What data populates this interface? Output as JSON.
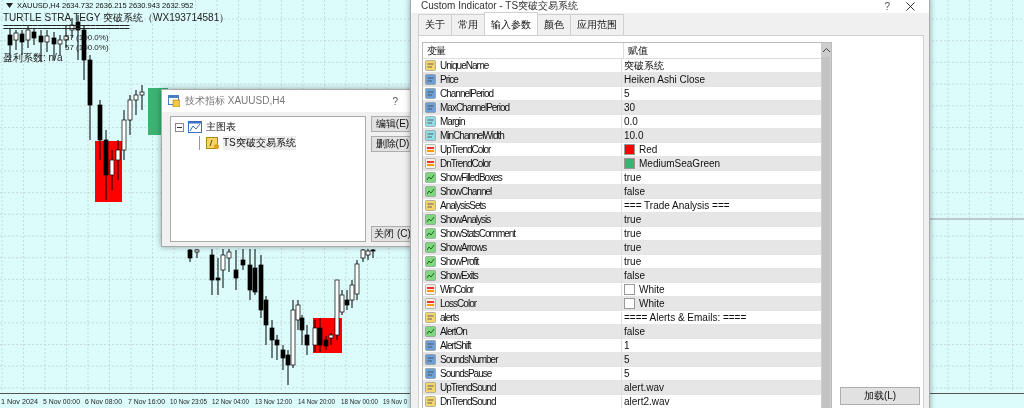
{
  "chart": {
    "symbol_header": "XAUUSD,H4 2634.732 2636.215 2630.943 2632.952",
    "comment_lines": [
      "TURTLE STRA TEGY 突破系统（WX193714581）",
      "==========================",
      "57 (100.0%)",
      "57 (100.0%)",
      "盈利系数: n/a"
    ],
    "date_labels": [
      "1 Nov 2024",
      "5 Nov 00:00",
      "6 Nov 08:00",
      "7 Nov 16:00",
      "10 Nov 23:05",
      "12 Nov 04:00",
      "13 Nov 12:00",
      "14 Nov 20:00",
      "18 Nov 00:00",
      "19 Nov 0"
    ]
  },
  "indicator_list_dialog": {
    "title": "技术指标 XAUUSD,H4",
    "help": "?",
    "tree": [
      {
        "label": "主图表",
        "expanded": true,
        "children": [
          {
            "label": "TS突破交易系统"
          }
        ]
      }
    ],
    "buttons": [
      "编辑(E)",
      "删除(D)",
      "关闭 (C)"
    ]
  },
  "custom_indicator_dialog": {
    "title": "Custom Indicator - TS突破交易系统",
    "help": "?",
    "tabs": [
      {
        "label": "关于",
        "selected": false
      },
      {
        "label": "常用",
        "selected": false
      },
      {
        "label": "输入参数",
        "selected": true
      },
      {
        "label": "颜色",
        "selected": false
      },
      {
        "label": "应用范围",
        "selected": false
      }
    ],
    "columns": [
      "变量",
      "赋值"
    ],
    "rows": [
      {
        "kind": "string",
        "name": "UniqueName",
        "value": "突破系统"
      },
      {
        "kind": "integer",
        "name": "Price",
        "value": "Heiken Ashi Close"
      },
      {
        "kind": "integer",
        "name": "ChannelPeriod",
        "value": "5"
      },
      {
        "kind": "integer",
        "name": "MaxChannelPeriod",
        "value": "30"
      },
      {
        "kind": "double",
        "name": "Margin",
        "value": "0.0"
      },
      {
        "kind": "double",
        "name": "MinChannelWidth",
        "value": "10.0"
      },
      {
        "kind": "color",
        "name": "UpTrendColor",
        "value": "Red",
        "color": "#ff0000"
      },
      {
        "kind": "color",
        "name": "DnTrendColor",
        "value": "MediumSeaGreen",
        "color": "#3cb371"
      },
      {
        "kind": "bool",
        "name": "ShowFilledBoxes",
        "value": "true"
      },
      {
        "kind": "bool",
        "name": "ShowChannel",
        "value": "false"
      },
      {
        "kind": "string",
        "name": "AnalysisSets",
        "value": "=== Trade Analysis ==="
      },
      {
        "kind": "bool",
        "name": "ShowAnalysis",
        "value": "true"
      },
      {
        "kind": "bool",
        "name": "ShowStatsComment",
        "value": "true"
      },
      {
        "kind": "bool",
        "name": "ShowArrows",
        "value": "true"
      },
      {
        "kind": "bool",
        "name": "ShowProfit",
        "value": "true"
      },
      {
        "kind": "bool",
        "name": "ShowExits",
        "value": "false"
      },
      {
        "kind": "color",
        "name": "WinColor",
        "value": "White",
        "color": "#ffffff"
      },
      {
        "kind": "color",
        "name": "LossColor",
        "value": "White",
        "color": "#ffffff"
      },
      {
        "kind": "string",
        "name": "alerts",
        "value": "==== Alerts & Emails: ===="
      },
      {
        "kind": "bool",
        "name": "AlertOn",
        "value": "false"
      },
      {
        "kind": "integer",
        "name": "AlertShift",
        "value": "1"
      },
      {
        "kind": "integer",
        "name": "SoundsNumber",
        "value": "5"
      },
      {
        "kind": "integer",
        "name": "SoundsPause",
        "value": "5"
      },
      {
        "kind": "string",
        "name": "UpTrendSound",
        "value": "alert.wav"
      },
      {
        "kind": "string",
        "name": "DnTrendSound",
        "value": "alert2.wav"
      }
    ],
    "load_button": "加载(L)"
  }
}
